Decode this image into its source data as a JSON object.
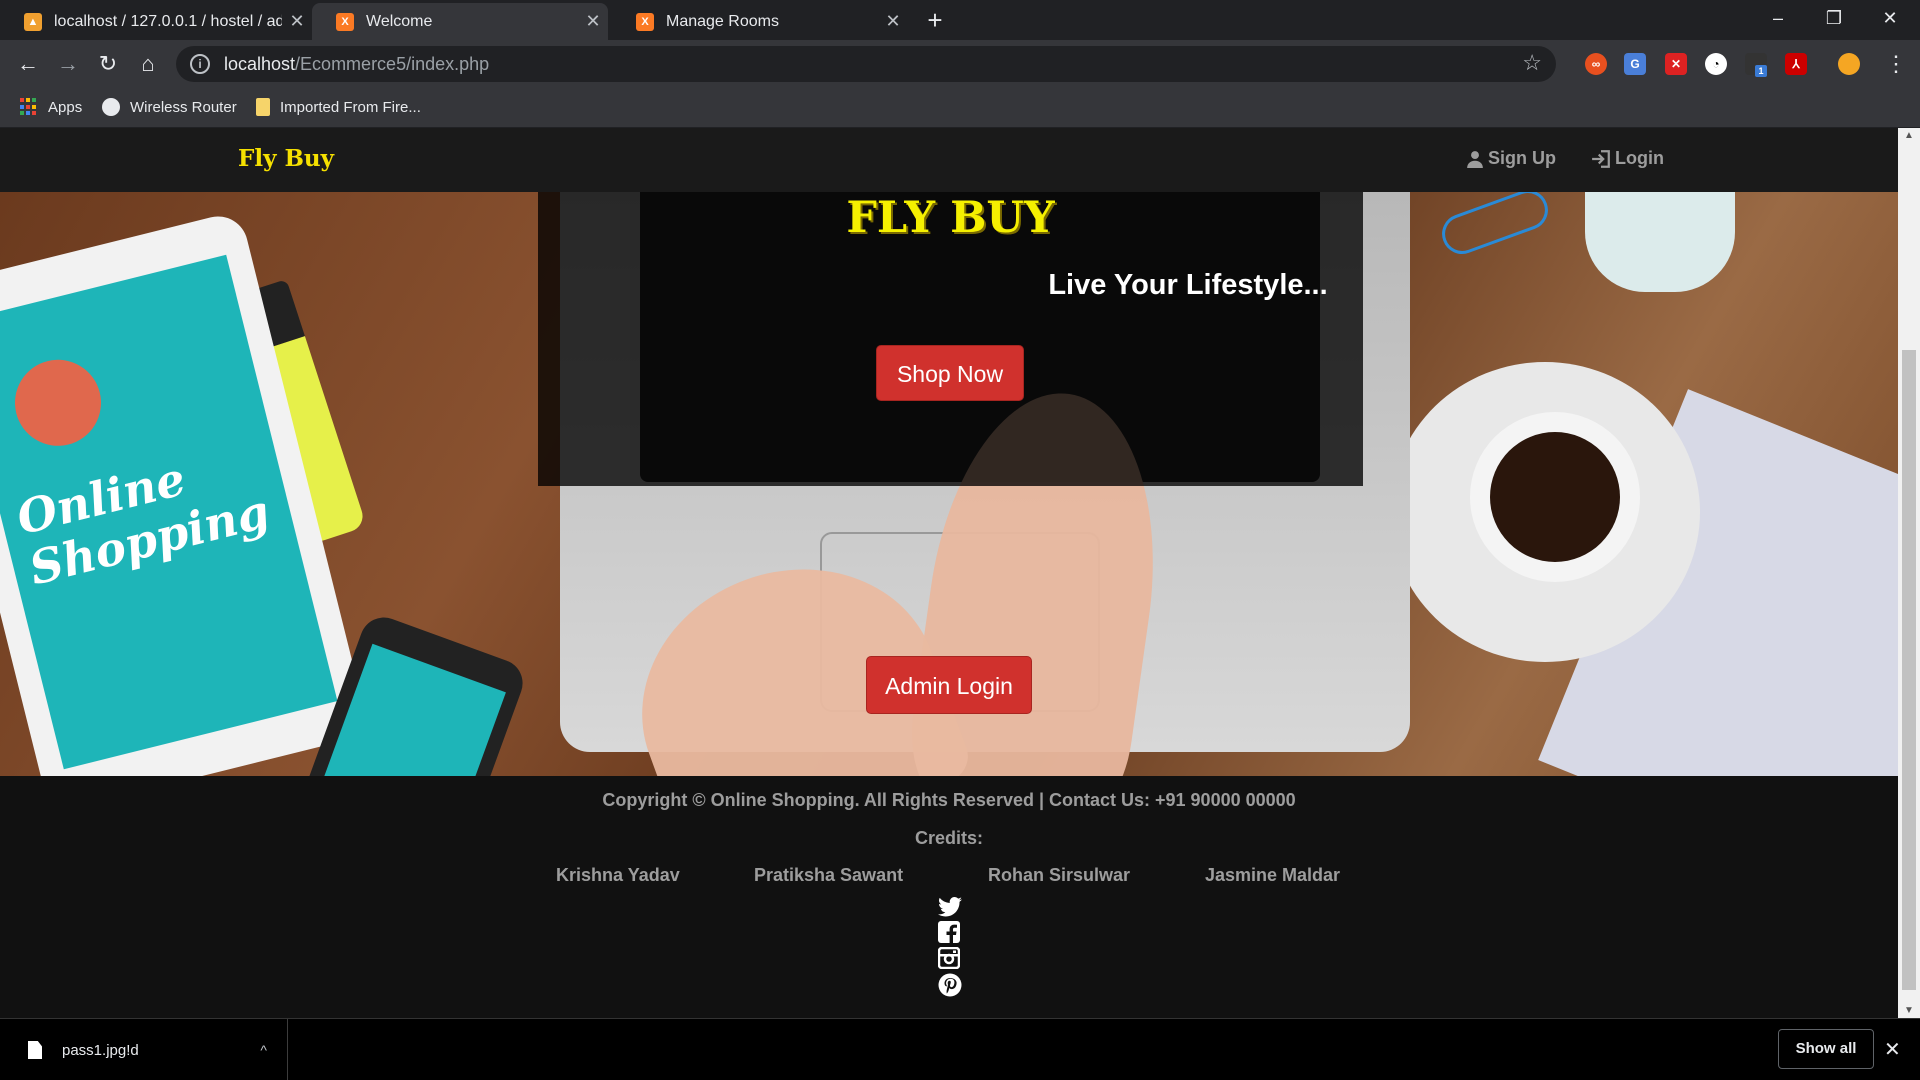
{
  "browser": {
    "tabs": [
      {
        "title": "localhost / 127.0.0.1 / hostel / ad",
        "favicon": "phpmyadmin-icon",
        "active": false
      },
      {
        "title": "Welcome",
        "favicon": "xampp-icon",
        "active": true
      },
      {
        "title": "Manage Rooms",
        "favicon": "xampp-icon",
        "active": false
      }
    ],
    "address": {
      "host": "localhost",
      "path": "/Ecommerce5/index.php"
    },
    "bookmarks": [
      {
        "label": "Apps",
        "icon": "apps-grid-icon"
      },
      {
        "label": "Wireless Router",
        "icon": "globe-icon"
      },
      {
        "label": "Imported From Fire...",
        "icon": "folder-icon"
      }
    ],
    "extension_badge": "1"
  },
  "site": {
    "brand": "Fly Buy",
    "nav": {
      "signup": "Sign Up",
      "login": "Login"
    },
    "hero": {
      "title": "FLY BUY",
      "subtitle": "Live Your Lifestyle...",
      "shop_button": "Shop Now",
      "admin_button": "Admin Login",
      "image_text": "Online Shopping"
    },
    "footer": {
      "copyright": "Copyright © Online Shopping. All Rights Reserved | Contact Us: +91 90000 00000",
      "credits_label": "Credits:",
      "credits": [
        "Krishna Yadav",
        "Pratiksha Sawant",
        "Rohan Sirsulwar",
        "Jasmine Maldar"
      ],
      "social_icons": [
        "twitter-icon",
        "facebook-icon",
        "instagram-icon",
        "pinterest-icon"
      ]
    }
  },
  "downloads": {
    "file": "pass1.jpg!d",
    "show_all": "Show all"
  },
  "colors": {
    "brand_yellow": "#f5e000",
    "button_red": "#d0312d",
    "navbar": "#1a1a1a",
    "footer": "#111111"
  }
}
